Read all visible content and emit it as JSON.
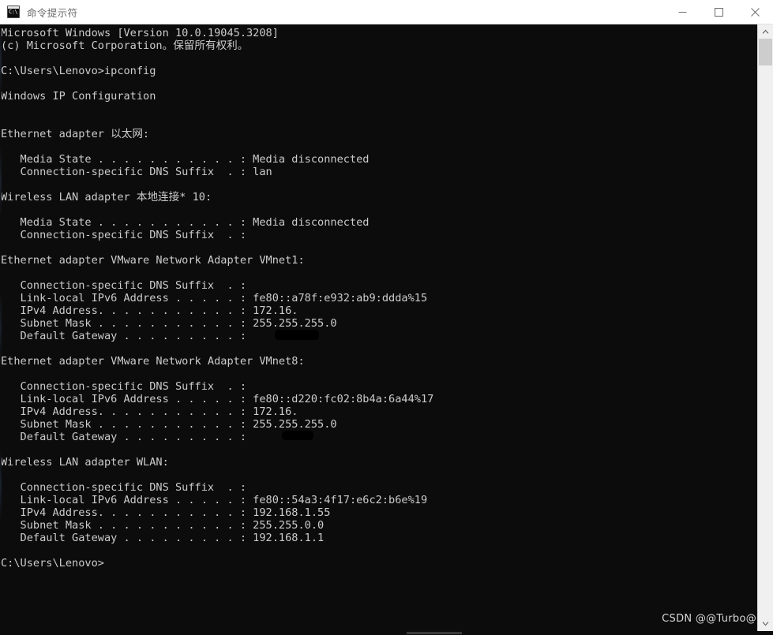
{
  "window": {
    "title": "命令提示符",
    "icon_label": "C:\\",
    "controls": {
      "minimize": "最小化",
      "maximize": "最大化",
      "close": "关闭"
    }
  },
  "theme": {
    "background": "#0c0c0c",
    "foreground": "#cccccc",
    "titlebar_background": "#ffffff",
    "titlebar_foreground": "#6a6a6a",
    "scrollbar_track": "#f0f0f0",
    "scrollbar_thumb": "#cdcdcd"
  },
  "terminal": {
    "command": "ipconfig",
    "prompt": "C:\\Users\\Lenovo>",
    "lines": [
      "Microsoft Windows [Version 10.0.19045.3208]",
      "(c) Microsoft Corporation。保留所有权利。",
      "",
      "C:\\Users\\Lenovo>ipconfig",
      "",
      "Windows IP Configuration",
      "",
      "",
      "Ethernet adapter 以太网:",
      "",
      "   Media State . . . . . . . . . . . : Media disconnected",
      "   Connection-specific DNS Suffix  . : lan",
      "",
      "Wireless LAN adapter 本地连接* 10:",
      "",
      "   Media State . . . . . . . . . . . : Media disconnected",
      "   Connection-specific DNS Suffix  . :",
      "",
      "Ethernet adapter VMware Network Adapter VMnet1:",
      "",
      "   Connection-specific DNS Suffix  . :",
      "   Link-local IPv6 Address . . . . . : fe80::a78f:e932:ab9:ddda%15",
      "   IPv4 Address. . . . . . . . . . . : 172.16.",
      "   Subnet Mask . . . . . . . . . . . : 255.255.255.0",
      "   Default Gateway . . . . . . . . . :",
      "",
      "Ethernet adapter VMware Network Adapter VMnet8:",
      "",
      "   Connection-specific DNS Suffix  . :",
      "   Link-local IPv6 Address . . . . . : fe80::d220:fc02:8b4a:6a44%17",
      "   IPv4 Address. . . . . . . . . . . : 172.16.",
      "   Subnet Mask . . . . . . . . . . . : 255.255.255.0",
      "   Default Gateway . . . . . . . . . :",
      "",
      "Wireless LAN adapter WLAN:",
      "",
      "   Connection-specific DNS Suffix  . :",
      "   Link-local IPv6 Address . . . . . : fe80::54a3:4f17:e6c2:b6e%19",
      "   IPv4 Address. . . . . . . . . . . : 192.168.1.55",
      "   Subnet Mask . . . . . . . . . . . : 255.255.0.0",
      "   Default Gateway . . . . . . . . . : 192.168.1.1",
      "",
      "C:\\Users\\Lenovo>"
    ],
    "adapters": [
      {
        "name": "Ethernet adapter 以太网",
        "media_state": "Media disconnected",
        "dns_suffix": "lan"
      },
      {
        "name": "Wireless LAN adapter 本地连接* 10",
        "media_state": "Media disconnected",
        "dns_suffix": ""
      },
      {
        "name": "Ethernet adapter VMware Network Adapter VMnet1",
        "dns_suffix": "",
        "ipv6_link_local": "fe80::a78f:e932:ab9:ddda%15",
        "ipv4": "172.16.",
        "ipv4_redacted": true,
        "subnet_mask": "255.255.255.0",
        "default_gateway": ""
      },
      {
        "name": "Ethernet adapter VMware Network Adapter VMnet8",
        "dns_suffix": "",
        "ipv6_link_local": "fe80::d220:fc02:8b4a:6a44%17",
        "ipv4": "172.16.",
        "ipv4_redacted": true,
        "subnet_mask": "255.255.255.0",
        "default_gateway": ""
      },
      {
        "name": "Wireless LAN adapter WLAN",
        "dns_suffix": "",
        "ipv6_link_local": "fe80::54a3:4f17:e6c2:b6e%19",
        "ipv4": "192.168.1.55",
        "ipv4_redacted": false,
        "subnet_mask": "255.255.0.0",
        "default_gateway": "192.168.1.1"
      }
    ]
  },
  "watermark": {
    "text": "CSDN @@Turbo@"
  }
}
